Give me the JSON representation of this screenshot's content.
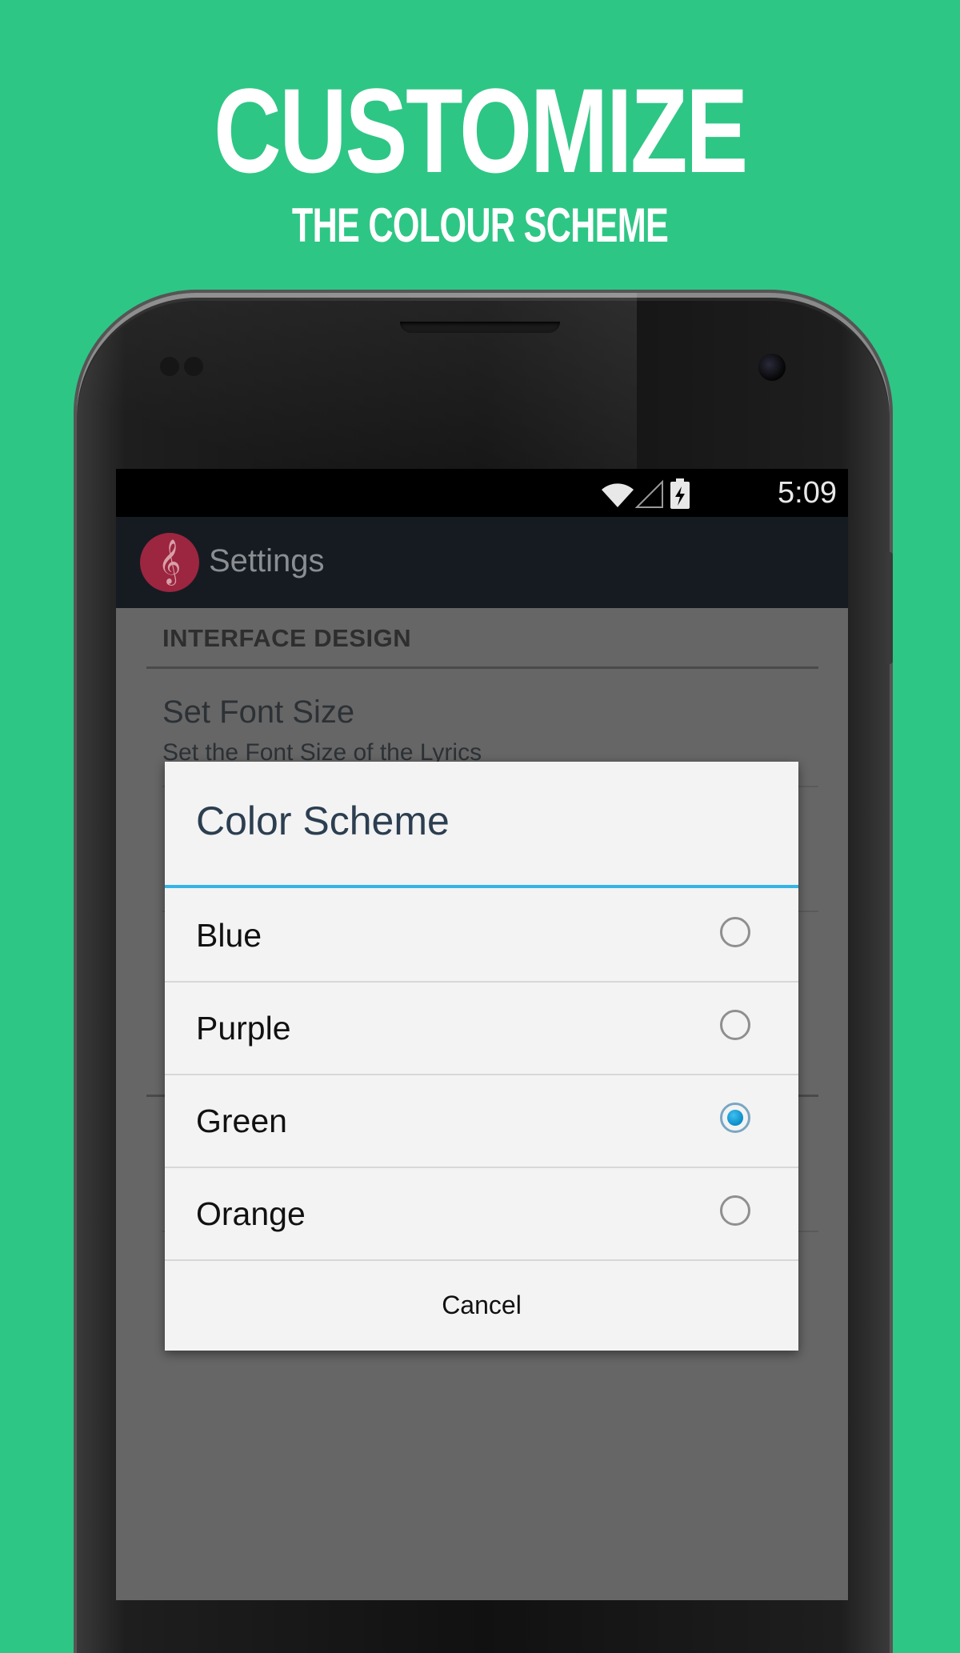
{
  "promo": {
    "title": "CUSTOMIZE",
    "subtitle": "THE COLOUR SCHEME"
  },
  "status_bar": {
    "time": "5:09",
    "icons": [
      "wifi-icon",
      "signal-icon",
      "battery-charging-icon"
    ]
  },
  "action_bar": {
    "title": "Settings",
    "logo_icon": "treble-clef-icon",
    "logo_glyph": "𝄞"
  },
  "settings": {
    "section_header": "INTERFACE DESIGN",
    "items": [
      {
        "title": "Set Font Size",
        "summary": "Set the Font Size of the Lyrics"
      }
    ]
  },
  "dialog": {
    "title": "Color Scheme",
    "options": [
      {
        "label": "Blue",
        "selected": false
      },
      {
        "label": "Purple",
        "selected": false
      },
      {
        "label": "Green",
        "selected": true
      },
      {
        "label": "Orange",
        "selected": false
      }
    ],
    "cancel_label": "Cancel"
  },
  "colors": {
    "background": "#2ec685",
    "dialog_accent": "#33b5e5",
    "logo": "#9c2540"
  }
}
